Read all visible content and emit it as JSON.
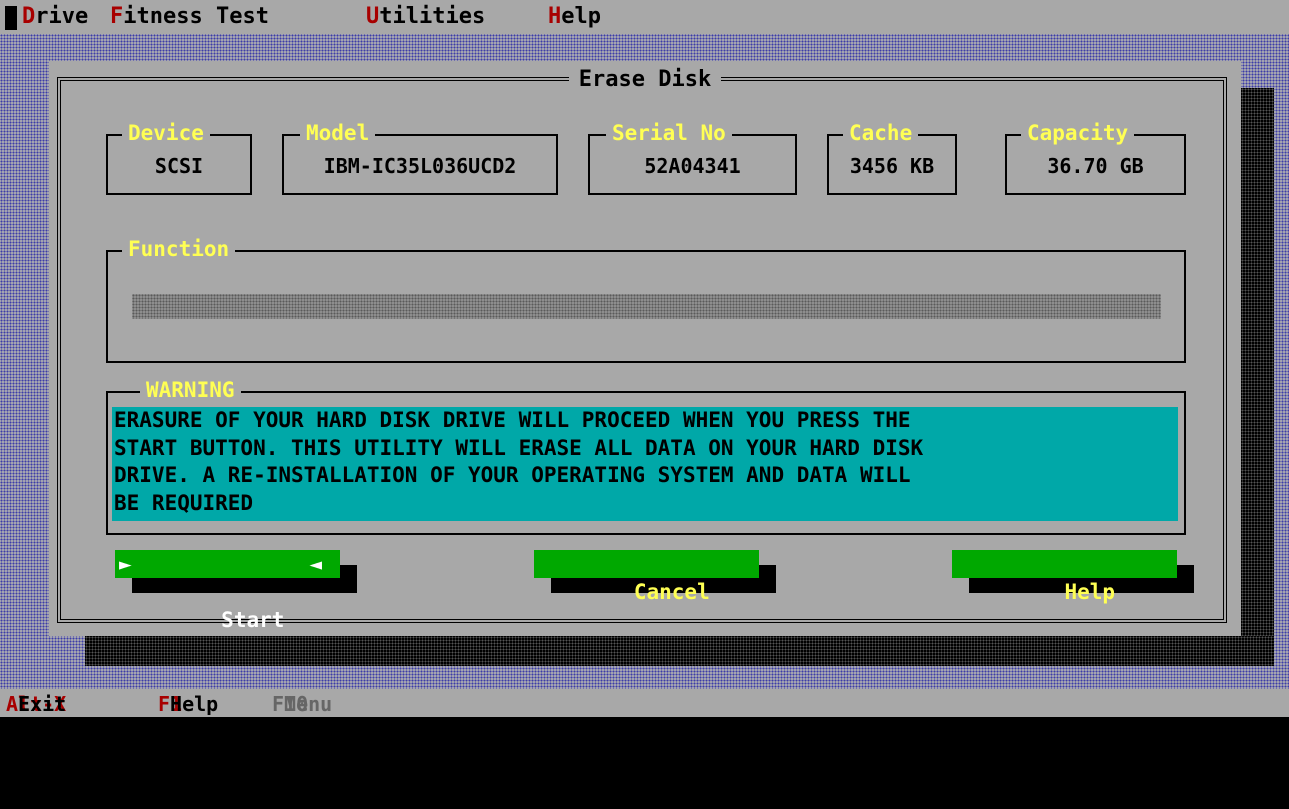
{
  "menubar": {
    "items": [
      {
        "hotkey": "D",
        "rest": "rive"
      },
      {
        "hotkey": "F",
        "rest": "itness Test"
      },
      {
        "hotkey": "U",
        "rest": "tilities"
      },
      {
        "hotkey": "H",
        "rest": "elp"
      }
    ]
  },
  "dialog": {
    "title": "Erase Disk",
    "fields": [
      {
        "label": "Device",
        "value": "SCSI"
      },
      {
        "label": "Model",
        "value": "IBM-IC35L036UCD2"
      },
      {
        "label": "Serial No",
        "value": "52A04341"
      },
      {
        "label": "Cache",
        "value": "3456 KB"
      },
      {
        "label": "Capacity",
        "value": "36.70 GB"
      }
    ],
    "function_label": "Function",
    "progress": 0,
    "warning_label": "WARNING",
    "warning_lines": [
      "ERASURE OF YOUR HARD DISK DRIVE WILL PROCEED WHEN YOU PRESS THE",
      "START BUTTON. THIS UTILITY WILL ERASE ALL DATA ON YOUR HARD DISK",
      "DRIVE. A RE-INSTALLATION OF YOUR OPERATING SYSTEM AND DATA WILL",
      "BE REQUIRED"
    ],
    "buttons": {
      "start": "Start",
      "cancel_hot": "C",
      "cancel_rest": "ancel",
      "help_hot": "H",
      "help_rest": "elp"
    }
  },
  "statusbar": {
    "exit_key": "Alt-X",
    "exit_label": "Exit",
    "help_key": "F1",
    "help_label": "Help",
    "menu_key": "F10",
    "menu_label": "Menu"
  },
  "colors": {
    "desktop_pattern": "#3c3ca8",
    "window_bg": "#a8a8a8",
    "label_yellow": "#ffff54",
    "hotkey_red": "#a80000",
    "button_green": "#00a800",
    "warning_cyan": "#00a8a8"
  }
}
